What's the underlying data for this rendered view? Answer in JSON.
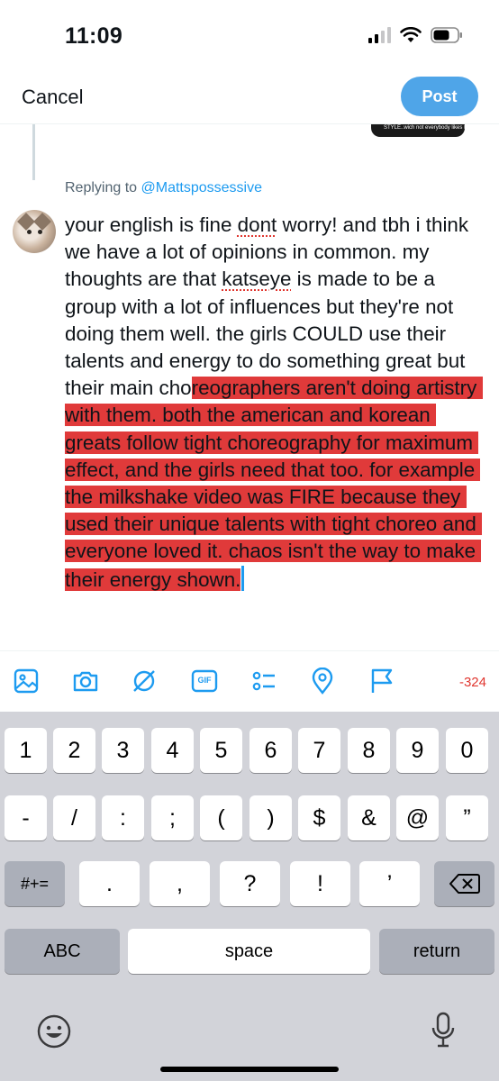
{
  "status_bar": {
    "time": "11:09"
  },
  "nav": {
    "cancel_label": "Cancel",
    "post_label": "Post"
  },
  "quoted_snippet": "STYLE..wich not everybody likes I get",
  "replying": {
    "prefix": "Replying to ",
    "handle": "@Mattspossessive"
  },
  "compose": {
    "seg1": "your english is fine ",
    "seg2": "dont",
    "seg3": " worry! and tbh i think we have a lot of opinions in common. my thoughts are that ",
    "seg4": "katseye",
    "seg5": " is made to be a group with a lot of influences but they're not doing them well. the girls COULD use their talents and energy to do something great but their main cho",
    "highlighted": "reographers aren't doing artistry with them. both the american and korean greats follow tight choreography for maximum effect, and the girls need that too. for example the milkshake video was FIRE because they used their unique talents with tight choreo and everyone loved it. chaos isn't the way to make their energy shown."
  },
  "toolbar": {
    "icons": [
      "image-icon",
      "camera-icon",
      "alt-text-icon",
      "gif-icon",
      "poll-icon",
      "location-icon",
      "flag-icon"
    ],
    "gif_label": "GIF",
    "char_count": "-324"
  },
  "keyboard": {
    "row1": [
      "1",
      "2",
      "3",
      "4",
      "5",
      "6",
      "7",
      "8",
      "9",
      "0"
    ],
    "row2": [
      "-",
      "/",
      ":",
      ";",
      "(",
      ")",
      "$",
      "&",
      "@",
      "”"
    ],
    "row3_left": "#+=",
    "row3": [
      ".",
      ",",
      "?",
      "!",
      "’"
    ],
    "abc_label": "ABC",
    "space_label": "space",
    "return_label": "return"
  },
  "colors": {
    "accent": "#1d9bf0",
    "post_button": "#4fa5e8",
    "highlight": "#e03a3a",
    "error": "#e0362f"
  }
}
